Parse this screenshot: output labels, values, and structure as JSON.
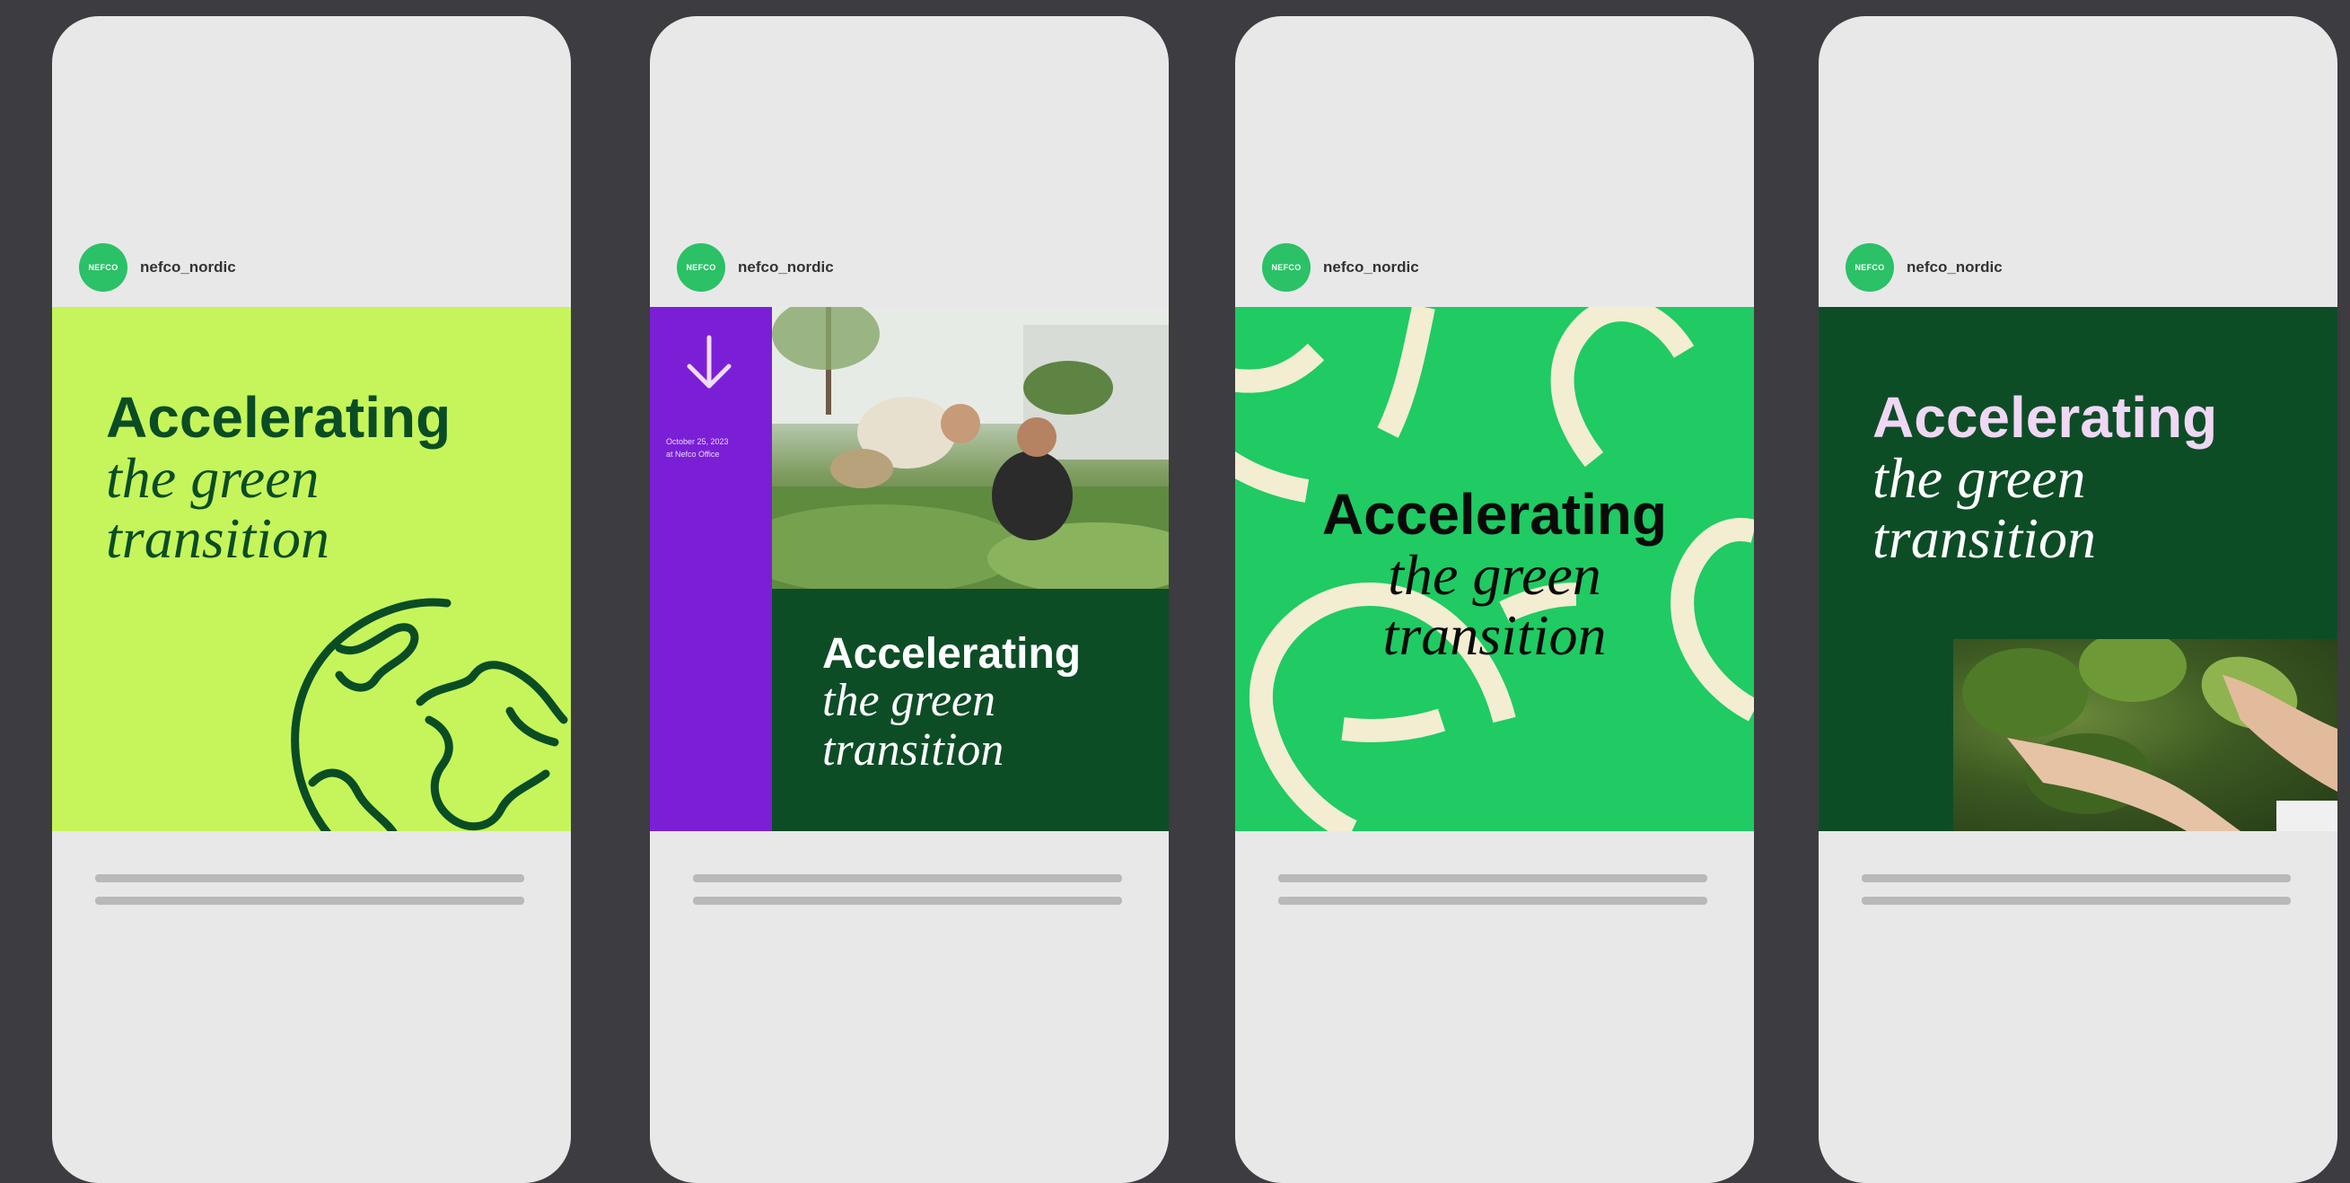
{
  "account": {
    "logo_text": "NEFCO",
    "username": "nefco_nordic"
  },
  "headline": {
    "line1": "Accelerating",
    "line2": "the green",
    "line3": "transition"
  },
  "post2": {
    "date_line1": "October 25, 2023",
    "date_line2": "at Nefco Office"
  },
  "colors": {
    "lime": "#c6f55b",
    "dark_green": "#0d4d26",
    "bright_green": "#1fcb62",
    "purple": "#7b1fd6",
    "cream": "#f3edd2"
  },
  "icons": {
    "post1": "globe-icon",
    "post2": "arrow-down-icon"
  }
}
